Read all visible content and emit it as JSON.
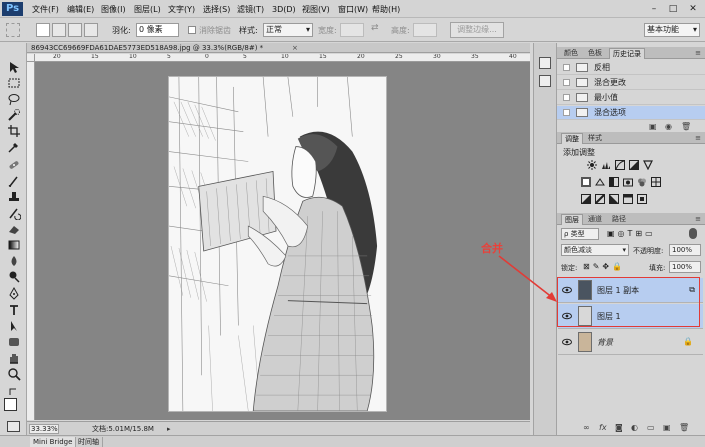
{
  "app": {
    "logo": "Ps",
    "workspace": "基本功能"
  },
  "menu": [
    "文件(F)",
    "编辑(E)",
    "图像(I)",
    "图层(L)",
    "文字(Y)",
    "选择(S)",
    "滤镜(T)",
    "3D(D)",
    "视图(V)",
    "窗口(W)",
    "帮助(H)"
  ],
  "window_controls": {
    "minimize": "–",
    "maximize": "□",
    "close": "✕"
  },
  "options": {
    "feather_label": "羽化:",
    "feather_value": "0 像素",
    "antialias_label": "消除锯齿",
    "style_label": "样式:",
    "style_value": "正常",
    "width_label": "宽度:",
    "height_label": "高度:",
    "refine_edge": "调整边缘..."
  },
  "document": {
    "tab_title": "86943CC69669FDA61DAE5773ED518A98.jpg @ 33.3%(RGB/8#) *",
    "close": "×",
    "zoom": "33.33%",
    "info": "文档:5.01M/15.8M",
    "ruler_marks": [
      "20",
      "15",
      "10",
      "5",
      "0",
      "5",
      "10",
      "15",
      "20",
      "25",
      "30",
      "35",
      "40"
    ]
  },
  "bottom_tabs": [
    "Mini Bridge",
    "时间轴"
  ],
  "history_panel": {
    "tabs": [
      "颜色",
      "色板",
      "历史记录"
    ],
    "items": [
      {
        "label": "反相",
        "selected": false
      },
      {
        "label": "混合更改",
        "selected": false
      },
      {
        "label": "最小值",
        "selected": false
      },
      {
        "label": "混合选项",
        "selected": true
      }
    ]
  },
  "adjust_panel": {
    "tabs": [
      "调整",
      "样式"
    ],
    "heading": "添加调整"
  },
  "layers_panel": {
    "tabs": [
      "图层",
      "通道",
      "路径"
    ],
    "filter": "ρ 类型",
    "blend_mode": "颜色减淡",
    "opacity_label": "不透明度:",
    "opacity_value": "100%",
    "lock_label": "锁定:",
    "fill_label": "填充:",
    "fill_value": "100%",
    "layers": [
      {
        "name": "图层 1 副本",
        "selected": true
      },
      {
        "name": "图层 1",
        "selected": true
      },
      {
        "name": "背景",
        "selected": false
      }
    ]
  },
  "annotation": {
    "label": "合并",
    "color": "#e23b36"
  },
  "colors": {
    "selection": "#b7cdf0",
    "canvas_bg": "#858585"
  }
}
